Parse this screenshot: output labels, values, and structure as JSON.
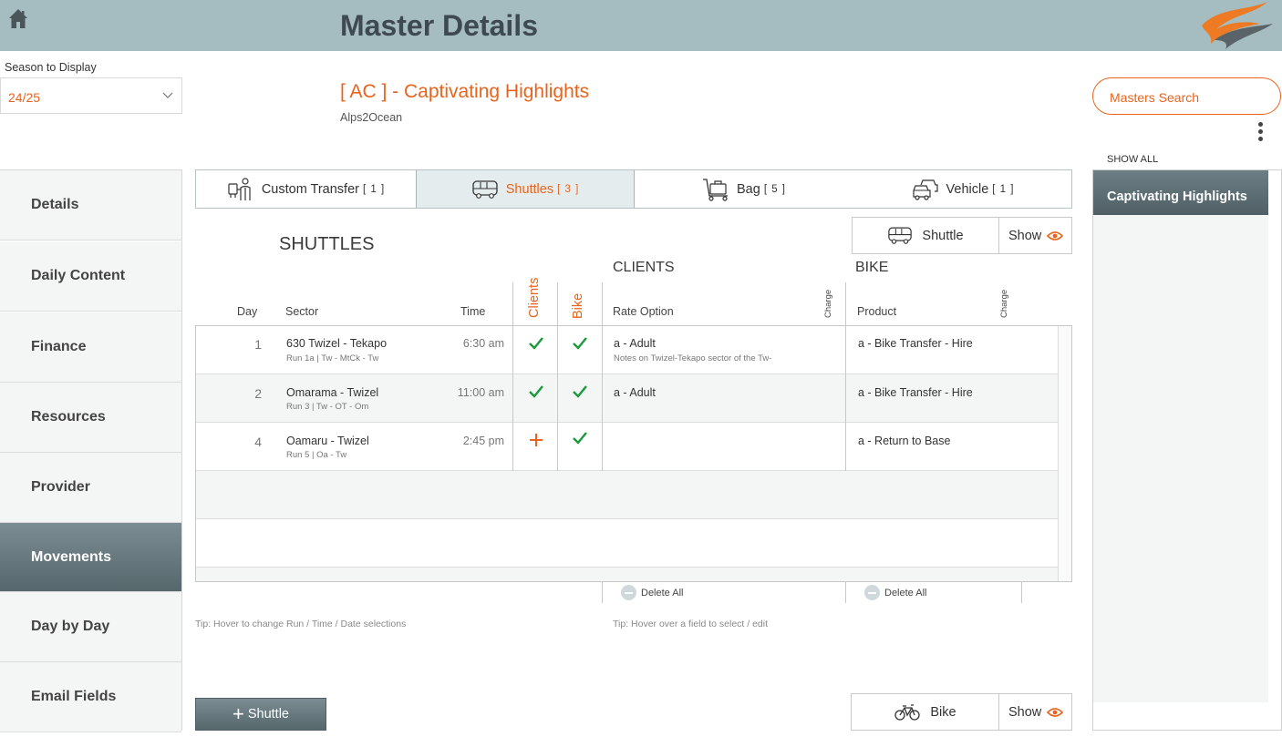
{
  "header": {
    "title": "Master Details"
  },
  "season": {
    "label": "Season to Display",
    "value": "24/25"
  },
  "master": {
    "title": "[ AC ] - Captivating Highlights",
    "subtitle": "Alps2Ocean"
  },
  "search": {
    "label": "Masters Search"
  },
  "right_panel": {
    "show_all": "SHOW ALL",
    "items": [
      "Captivating Highlights"
    ]
  },
  "sidebar": {
    "items": [
      "Details",
      "Daily Content",
      "Finance",
      "Resources",
      "Provider",
      "Movements",
      "Day by Day",
      "Email Fields"
    ],
    "active": "Movements"
  },
  "tabs": [
    {
      "label": "Custom Transfer",
      "count": "[ 1 ]",
      "icon": "person-transfer-icon"
    },
    {
      "label": "Shuttles",
      "count": "[ 3 ]",
      "icon": "bus-icon"
    },
    {
      "label": "Bag",
      "count": "[ 5 ]",
      "icon": "luggage-cart-icon"
    },
    {
      "label": "Vehicle",
      "count": "[ 1 ]",
      "icon": "cars-icon"
    }
  ],
  "shuttle_toggle": {
    "label": "Shuttle",
    "show": "Show"
  },
  "bike_toggle": {
    "label": "Bike",
    "show": "Show"
  },
  "section": {
    "title": "SHUTTLES",
    "clients_title": "CLIENTS",
    "bike_title": "BIKE"
  },
  "columns": {
    "day": "Day",
    "sector": "Sector",
    "time": "Time",
    "clients": "Clients",
    "bike": "Bike",
    "rate_option": "Rate Option",
    "charge": "Charge",
    "product": "Product"
  },
  "rows": [
    {
      "day": "1",
      "sector": "630 Twizel - Tekapo",
      "run": "Run 1a | Tw - MtCk - Tw",
      "time": "6:30 am",
      "clients": "check",
      "bike": "check",
      "rate_option": "a - Adult",
      "notes": "Notes on Twizel-Tekapo sector of the Tw-",
      "product": "a - Bike Transfer - Hire"
    },
    {
      "day": "2",
      "sector": "Omarama - Twizel",
      "run": "Run 3 | Tw - OT - Om",
      "time": "11:00 am",
      "clients": "check",
      "bike": "check",
      "rate_option": "a - Adult",
      "notes": "",
      "product": "a - Bike Transfer - Hire"
    },
    {
      "day": "4",
      "sector": "Oamaru - Twizel",
      "run": "Run 5 | Oa - Tw",
      "time": "2:45 pm",
      "clients": "plus",
      "bike": "check",
      "rate_option": "",
      "notes": "",
      "product": "a - Return to Base"
    }
  ],
  "delete_all": "Delete All",
  "tips": {
    "left": "Tip: Hover to change Run / Time / Date selections",
    "right": "Tip: Hover over a field to select / edit"
  },
  "add_button": {
    "label": "Shuttle"
  },
  "colors": {
    "accent": "#e8641c",
    "header_bg": "#a5bcc1",
    "nav_active": "#56676c",
    "check": "#1a9a3a"
  }
}
